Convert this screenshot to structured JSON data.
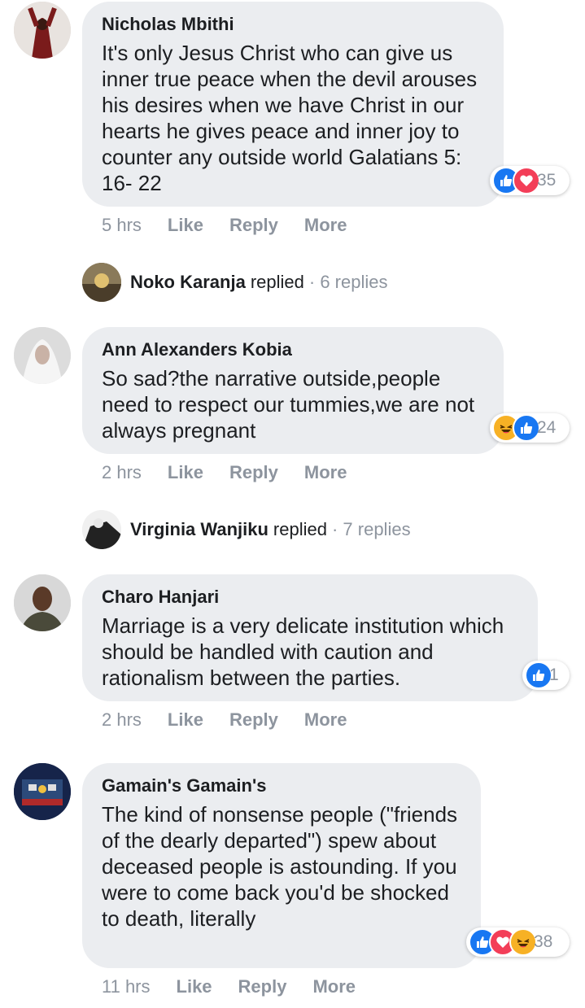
{
  "comments": [
    {
      "name": "Nicholas Mbithi",
      "text": "It's only Jesus Christ who can give us inner true peace when the devil arouses his desires when we have Christ in our hearts he gives peace and inner joy to counter any outside world Galatians 5: 16- 22",
      "time": "5 hrs",
      "reactions": [
        "like",
        "love"
      ],
      "reaction_count": "35",
      "reply": {
        "name": "Noko Karanja",
        "verb": "replied",
        "count": "· 6 replies"
      }
    },
    {
      "name": "Ann Alexanders Kobia",
      "text": "So sad?the narrative outside,people need to respect our tummies,we are not always pregnant",
      "time": "2 hrs",
      "reactions": [
        "haha",
        "like"
      ],
      "reaction_count": "24",
      "reply": {
        "name": "Virginia Wanjiku",
        "verb": "replied",
        "count": "· 7 replies"
      }
    },
    {
      "name": "Charo Hanjari",
      "text": "Marriage is a very delicate institution which should be handled with caution and rationalism between the parties.",
      "time": "2 hrs",
      "reactions": [
        "like"
      ],
      "reaction_count": "1"
    },
    {
      "name": "Gamain's Gamain's",
      "text": "The kind of nonsense people (\"friends of the dearly departed\") spew about deceased people is astounding. If you were to come back you'd be shocked to death, literally",
      "time": "11 hrs",
      "reactions": [
        "like",
        "love",
        "haha"
      ],
      "reaction_count": "38"
    }
  ],
  "actions": {
    "like": "Like",
    "reply": "Reply",
    "more": "More"
  },
  "colors": {
    "like_blue": "#1877f2",
    "love_red": "#f33e58",
    "haha_yellow": "#f7b125",
    "bubble": "#ebedf0",
    "meta_gray": "#8d949e"
  }
}
